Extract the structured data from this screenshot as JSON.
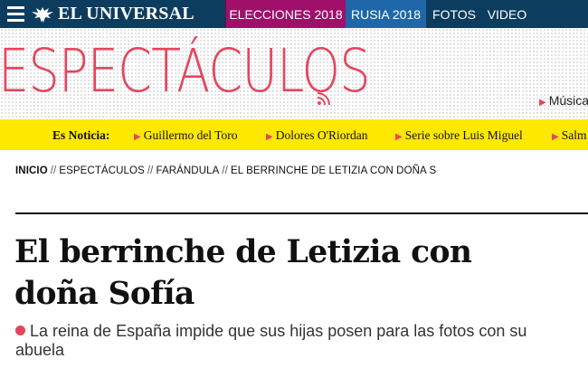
{
  "topbar": {
    "brand": "EL UNIVERSAL",
    "tabs": [
      {
        "label": "ELECCIONES 2018",
        "color": "#a0106a"
      },
      {
        "label": "RUSIA 2018",
        "color": "#1f67a8"
      },
      {
        "label": "FOTOS"
      },
      {
        "label": "VIDEO"
      }
    ],
    "bar_color": "#0d3d5e"
  },
  "section": {
    "title": "ESPECTÁCULOS",
    "title_color": "#e5455f",
    "link": "Música"
  },
  "es_noticia": {
    "label": "Es Noticia:",
    "items": [
      "Guillermo del Toro",
      "Dolores O'Riordan",
      "Serie sobre Luis Miguel",
      "Salm"
    ],
    "bar_color": "#ffe800"
  },
  "breadcrumb": {
    "items": [
      "INICIO",
      "ESPECTÁCULOS",
      "FARÁNDULA",
      "EL BERRINCHE DE LETIZIA CON DOÑA S"
    ],
    "separator": "//"
  },
  "article": {
    "headline_line1": "El berrinche de Letizia con",
    "headline_line2": "doña Sofía",
    "dek_line1": "La reina de España impide que sus hijas posen para las fotos con su",
    "dek_line2": "abuela"
  }
}
